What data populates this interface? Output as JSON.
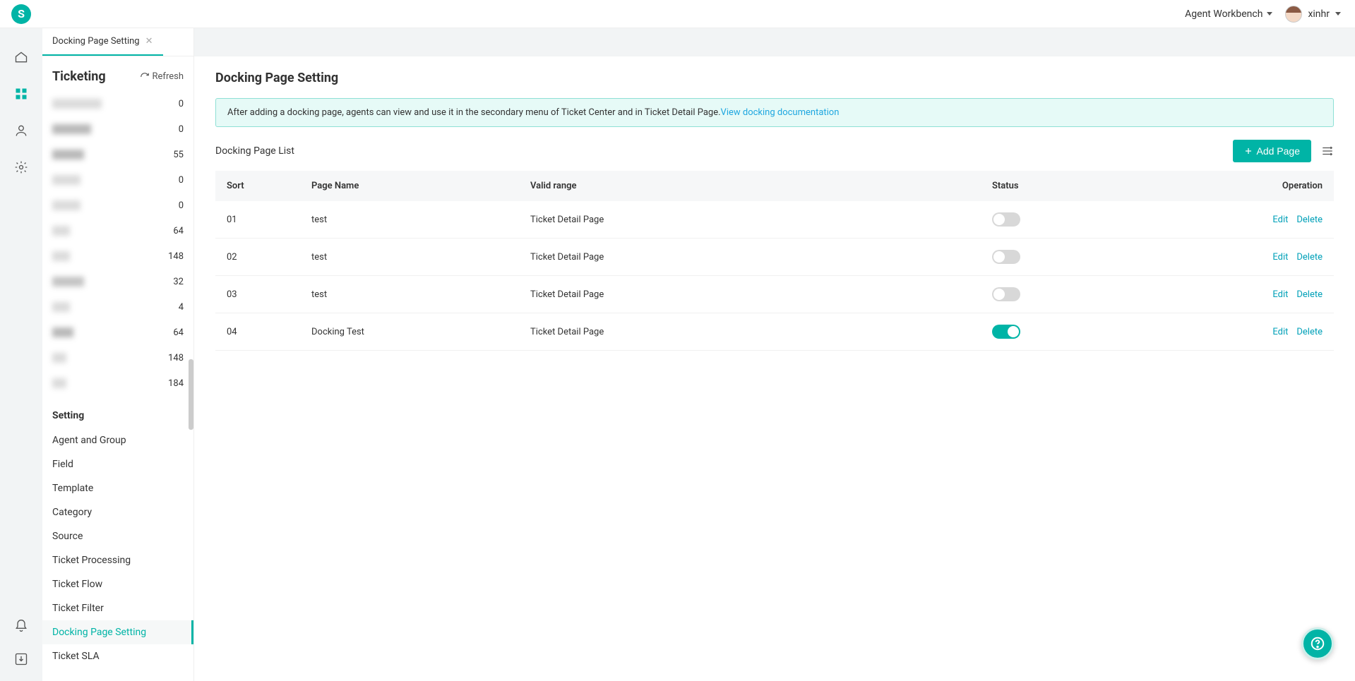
{
  "header": {
    "workbench": "Agent Workbench",
    "username": "xinhr"
  },
  "sidepanel": {
    "tab": "Docking Page Setting",
    "title": "Ticketing",
    "refresh": "Refresh",
    "counts": [
      "0",
      "0",
      "55",
      "0",
      "0",
      "64",
      "148",
      "32",
      "4",
      "64",
      "148",
      "184"
    ],
    "setting_title": "Setting",
    "settings": [
      "Agent and Group",
      "Field",
      "Template",
      "Category",
      "Source",
      "Ticket Processing",
      "Ticket Flow",
      "Ticket Filter",
      "Docking Page Setting",
      "Ticket SLA"
    ],
    "active_index": 8
  },
  "main": {
    "title": "Docking Page Setting",
    "banner_text": "After adding a docking page, agents can view and use it in the secondary menu of Ticket Center and in Ticket Detail Page.",
    "banner_link": "View docking documentation",
    "list_label": "Docking Page List",
    "add_button": "Add Page",
    "columns": {
      "sort": "Sort",
      "name": "Page Name",
      "valid": "Valid range",
      "status": "Status",
      "op": "Operation"
    },
    "op_labels": {
      "edit": "Edit",
      "delete": "Delete"
    },
    "rows": [
      {
        "sort": "01",
        "name": "test",
        "valid": "Ticket Detail Page",
        "status": false
      },
      {
        "sort": "02",
        "name": "test",
        "valid": "Ticket Detail Page",
        "status": false
      },
      {
        "sort": "03",
        "name": "test",
        "valid": "Ticket Detail Page",
        "status": false
      },
      {
        "sort": "04",
        "name": "Docking Test",
        "valid": "Ticket Detail Page",
        "status": true
      }
    ]
  }
}
